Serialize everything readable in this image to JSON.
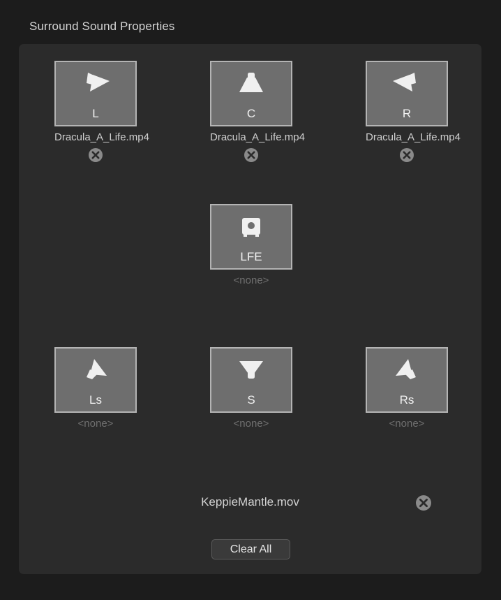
{
  "panel": {
    "title": "Surround Sound Properties"
  },
  "slots": [
    {
      "key": "L",
      "label": "L",
      "icon": "speaker-cone-left-icon",
      "file": "Dracula_A_Life.mp4",
      "assigned": true,
      "remove_label": "remove-l-assignment"
    },
    {
      "key": "C",
      "label": "C",
      "icon": "speaker-cone-center-icon",
      "file": "Dracula_A_Life.mp4",
      "assigned": true,
      "remove_label": "remove-c-assignment"
    },
    {
      "key": "R",
      "label": "R",
      "icon": "speaker-cone-right-icon",
      "file": "Dracula_A_Life.mp4",
      "assigned": true,
      "remove_label": "remove-r-assignment"
    },
    {
      "key": "LFE",
      "label": "LFE",
      "icon": "subwoofer-icon",
      "file": "<none>",
      "assigned": false,
      "remove_label": "remove-lfe-assignment"
    },
    {
      "key": "Ls",
      "label": "Ls",
      "icon": "speaker-cone-left-surround-icon",
      "file": "<none>",
      "assigned": false,
      "remove_label": "remove-ls-assignment"
    },
    {
      "key": "S",
      "label": "S",
      "icon": "speaker-cone-surround-icon",
      "file": "<none>",
      "assigned": false,
      "remove_label": "remove-s-assignment"
    },
    {
      "key": "Rs",
      "label": "Rs",
      "icon": "speaker-cone-right-surround-icon",
      "file": "<none>",
      "assigned": false,
      "remove_label": "remove-rs-assignment"
    }
  ],
  "source": {
    "name": "KeppieMantle.mov",
    "remove_icon": "remove-source-icon"
  },
  "actions": {
    "clear_all_label": "Clear All"
  },
  "colors": {
    "page_background": "#1c1c1c",
    "panel_background": "#2b2b2b",
    "tile_background": "#6e6e6e",
    "tile_border": "#b4b4b4",
    "icon_fill": "#f0f0f0",
    "text_primary": "#d2d2d2",
    "text_disabled": "#6f6f6f",
    "button_background": "#3a3a3a",
    "button_border": "#5b5b5b"
  }
}
